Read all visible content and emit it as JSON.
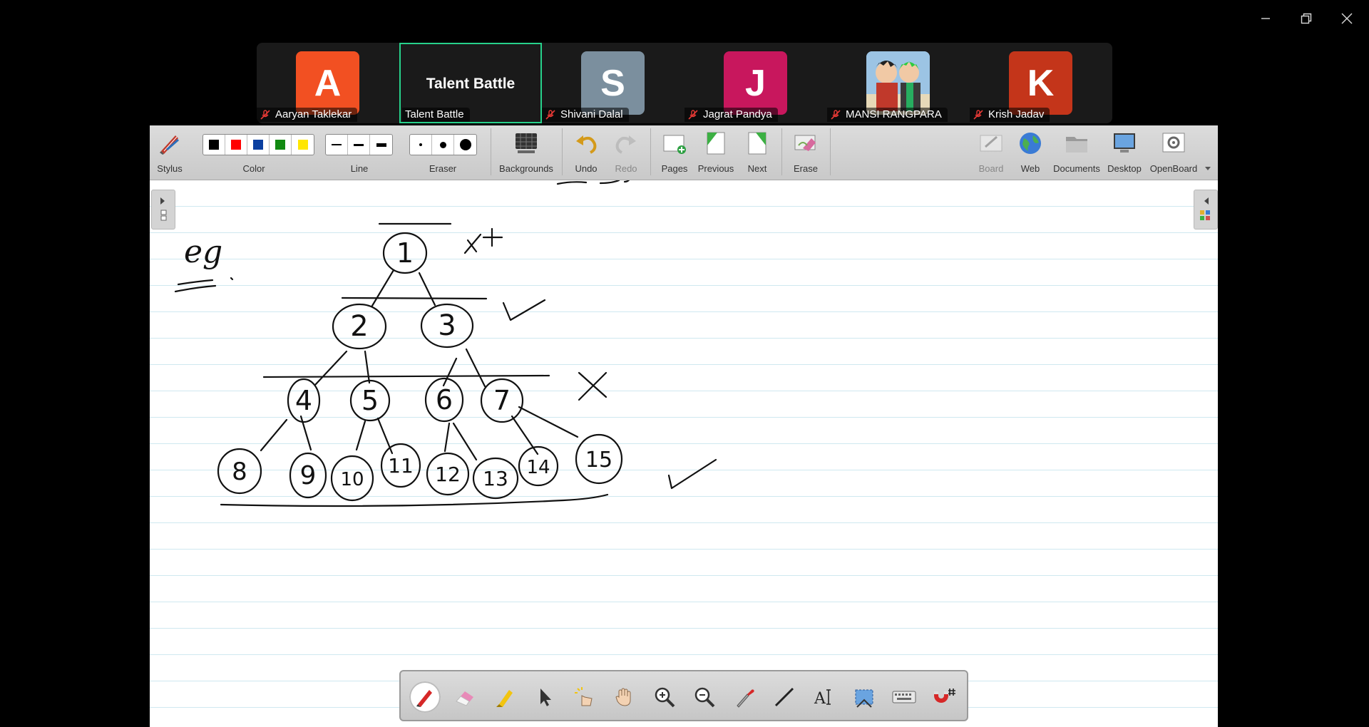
{
  "participants": [
    {
      "name": "Aaryan Taklekar",
      "initial": "A",
      "color": "#f25022",
      "muted": true
    },
    {
      "name": "Talent Battle",
      "shared_title": "Talent Battle",
      "active": true,
      "muted": false
    },
    {
      "name": "Shivani Dalal",
      "initial": "S",
      "color": "#7b8f9e",
      "muted": true
    },
    {
      "name": "Jagrat Pandya",
      "initial": "J",
      "color": "#c8175d",
      "muted": true
    },
    {
      "name": "MANSI RANGPARA",
      "initial": "",
      "avatar_icon": "anime-avatar-image",
      "muted": true
    },
    {
      "name": "Krish Jadav",
      "initial": "K",
      "color": "#c4351a",
      "muted": true
    }
  ],
  "toolbar": {
    "stylus": "Stylus",
    "color": "Color",
    "colors": [
      "#000000",
      "#ff0000",
      "#0a3fa0",
      "#128a12",
      "#ffe600"
    ],
    "line": "Line",
    "eraser": "Eraser",
    "backgrounds": "Backgrounds",
    "undo": "Undo",
    "redo": "Redo",
    "pages": "Pages",
    "previous": "Previous",
    "next": "Next",
    "erase": "Erase",
    "board": "Board",
    "web": "Web",
    "documents": "Documents",
    "desktop": "Desktop",
    "openboard": "OpenBoard"
  },
  "drawing": {
    "eg_label": "eg",
    "nodes": [
      "1",
      "2",
      "3",
      "4",
      "5",
      "6",
      "7",
      "8",
      "9",
      "10",
      "11",
      "12",
      "13",
      "14",
      "15"
    ]
  },
  "palette_tools": [
    "pen-icon",
    "eraser-icon",
    "highlighter-icon",
    "pointer-icon",
    "laser-pointer-icon",
    "hand-icon",
    "zoom-in-icon",
    "zoom-out-icon",
    "pipette-icon",
    "line-icon",
    "text-icon",
    "capture-icon",
    "keyboard-icon",
    "magnet-grid-icon"
  ]
}
